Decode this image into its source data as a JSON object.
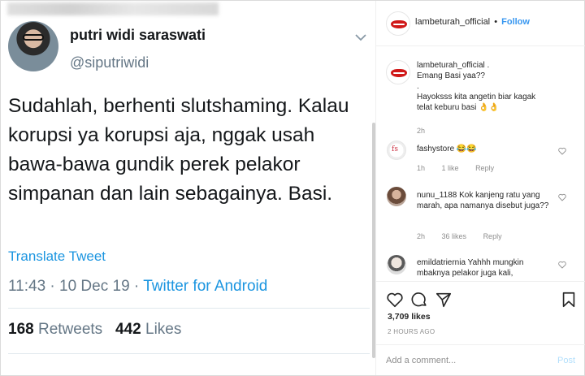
{
  "tweet": {
    "name": "putri widi saraswati",
    "handle": "@siputriwidi",
    "text": "Sudahlah, berhenti slutshaming. Kalau korupsi ya korupsi aja, nggak usah bawa-bawa gundik perek pelakor simpanan dan lain sebagainya. Basi.",
    "translate": "Translate Tweet",
    "time": "11:43 · 10 Dec 19 · ",
    "source": "Twitter for Android",
    "retweets_count": "168",
    "retweets_label": "Retweets",
    "likes_count": "442",
    "likes_label": "Likes"
  },
  "ig": {
    "header": {
      "username": "lambeturah_official",
      "dot": "•",
      "follow": "Follow"
    },
    "caption": {
      "username": "lambeturah_official",
      "line1": ".",
      "line2": "Emang Basi yaa??",
      "line3": ".",
      "line4": "Hayoksss kita angetin biar kagak telat keburu basi 👌👌",
      "time": "2h"
    },
    "comments": [
      {
        "username": "fashystore",
        "text": "😂😂",
        "time": "1h",
        "likes": "1 like",
        "reply": "Reply"
      },
      {
        "username": "nunu_1188",
        "text": "Kok kanjeng ratu yang marah, apa namanya disebut juga??",
        "time": "2h",
        "likes": "36 likes",
        "reply": "Reply"
      },
      {
        "username": "emildatriernia",
        "text": "Yahhh mungkin mbaknya pelakor juga kali,",
        "time": "",
        "likes": "",
        "reply": ""
      }
    ],
    "likes": "3,709 likes",
    "ago": "2 HOURS AGO",
    "add_comment_placeholder": "Add a comment...",
    "post": "Post"
  },
  "icons": [
    "chevron-down-icon",
    "heart-icon",
    "comment-icon",
    "share-icon",
    "bookmark-icon"
  ],
  "colors": {
    "twitter_blue": "#1b95e0",
    "ig_blue": "#3897f0",
    "muted": "#8e8e8e",
    "brand_red": "#d01818"
  }
}
